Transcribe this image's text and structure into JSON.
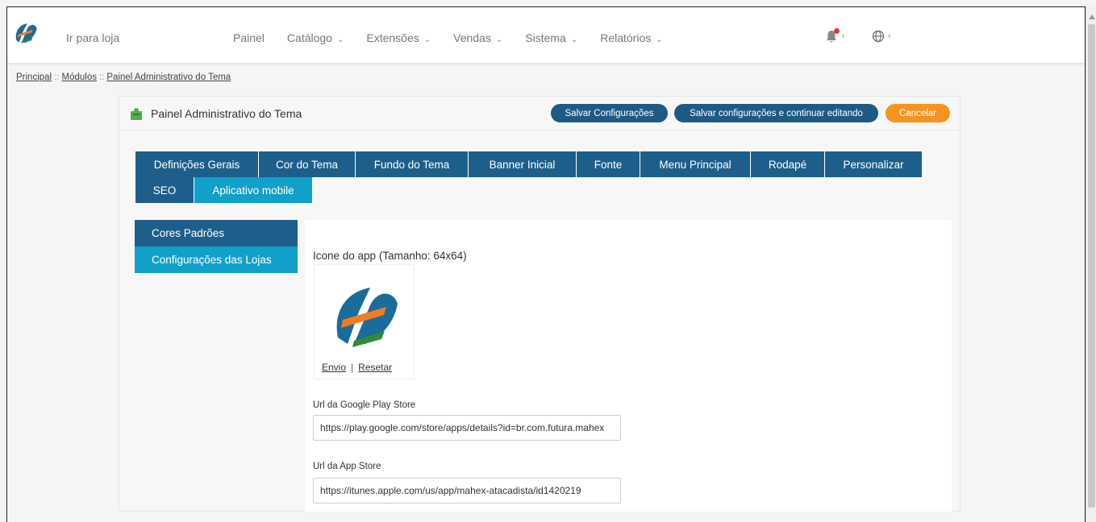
{
  "nav": {
    "goto_store": "Ir para loja",
    "items": [
      {
        "label": "Painel",
        "dropdown": false
      },
      {
        "label": "Catálogo",
        "dropdown": true
      },
      {
        "label": "Extensões",
        "dropdown": true
      },
      {
        "label": "Vendas",
        "dropdown": true
      },
      {
        "label": "Sistema",
        "dropdown": true
      },
      {
        "label": "Relatórios",
        "dropdown": true
      }
    ],
    "chevron": "⌄",
    "small_chevron": "‹"
  },
  "breadcrumb": {
    "items": [
      "Principal",
      "Módulos",
      "Painel Administrativo do Tema"
    ],
    "separator": "::"
  },
  "card": {
    "title": "Painel Administrativo do Tema",
    "save_label": "Salvar Configurações",
    "save_continue_label": "Salvar configurações e continuar editando",
    "cancel_label": "Cancelar"
  },
  "tabs": {
    "row1": [
      "Definições Gerais",
      "Cor do Tema",
      "Fundo do Tema",
      "Banner Inicial",
      "Fonte",
      "Menu Principal",
      "Rodapé",
      "Personalizar"
    ],
    "row2": [
      "SEO",
      "Aplicativo mobile"
    ],
    "active": "Aplicativo mobile"
  },
  "side": {
    "items": [
      "Cores Padrões",
      "Configurações das Lojas"
    ],
    "active": "Configurações das Lojas"
  },
  "form": {
    "icon_label": "Icone do app (Tamanho: 64x64)",
    "upload_label": "Envio",
    "reset_label": "Resetar",
    "links_separator": "|",
    "google_label": "Url da Google Play Store",
    "google_value": "https://play.google.com/store/apps/details?id=br.com.futura.mahex",
    "apple_label": "Url da App Store",
    "apple_value": "https://itunes.apple.com/us/app/mahex-atacadista/id1420219"
  },
  "colors": {
    "primary": "#1d5f8a",
    "active": "#11a0c8",
    "button": "#1f5a84",
    "cancel": "#f7931e",
    "logo_blue": "#1a6c9b",
    "logo_orange": "#f47b20",
    "logo_green": "#2e8b3a"
  },
  "icons": [
    "brand-logo",
    "bell-icon",
    "globe-icon",
    "puzzle-icon",
    "app-logo"
  ]
}
